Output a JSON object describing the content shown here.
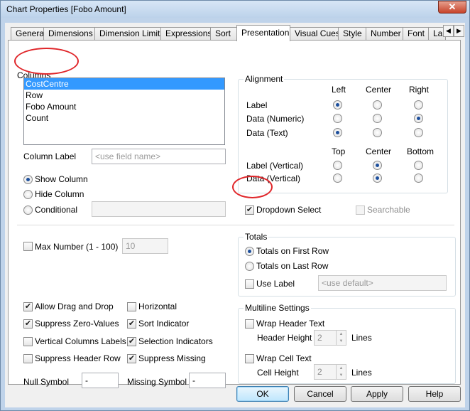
{
  "window": {
    "title": "Chart Properties [Fobo Amount]",
    "close_glyph": "✕"
  },
  "tabs": [
    "General",
    "Dimensions",
    "Dimension Limits",
    "Expressions",
    "Sort",
    "Presentation",
    "Visual Cues",
    "Style",
    "Number",
    "Font",
    "La"
  ],
  "active_tab": "Presentation",
  "tab_scroll": {
    "left": "◀",
    "right": "▶"
  },
  "columns": {
    "label": "Columns",
    "items": [
      "CostCentre",
      "Row",
      "Fobo Amount",
      "Count"
    ],
    "selected": "CostCentre",
    "column_label_text": "Column Label",
    "column_label_placeholder": "<use field name>",
    "show_column": "Show Column",
    "hide_column": "Hide Column",
    "conditional": "Conditional"
  },
  "alignment": {
    "label": "Alignment",
    "headers": [
      "Left",
      "Center",
      "Right"
    ],
    "rows": [
      {
        "label": "Label",
        "selected": "Left"
      },
      {
        "label": "Data (Numeric)",
        "selected": "Right"
      },
      {
        "label": "Data (Text)",
        "selected": "Left"
      }
    ],
    "vheaders": [
      "Top",
      "Center",
      "Bottom"
    ],
    "vrows": [
      {
        "label": "Label (Vertical)",
        "selected": "Center"
      },
      {
        "label": "Data (Vertical)",
        "selected": "Center"
      }
    ]
  },
  "dropdown_select": {
    "label": "Dropdown Select",
    "checked": true
  },
  "searchable": {
    "label": "Searchable",
    "checked": false
  },
  "max_number": {
    "label": "Max Number (1 - 100)",
    "value": "10"
  },
  "totals": {
    "label": "Totals",
    "first_row": "Totals on First Row",
    "last_row": "Totals on Last Row",
    "use_label": "Use Label",
    "use_label_placeholder": "<use default>"
  },
  "options": {
    "allow_drag_drop": "Allow Drag and Drop",
    "suppress_zero": "Suppress Zero-Values",
    "vertical_col_labels": "Vertical Columns Labels",
    "suppress_header": "Suppress Header Row",
    "horizontal": "Horizontal",
    "sort_indicator": "Sort Indicator",
    "selection_indicators": "Selection Indicators",
    "suppress_missing": "Suppress Missing"
  },
  "null_symbol": {
    "label": "Null Symbol",
    "value": "-"
  },
  "missing_symbol": {
    "label": "Missing Symbol",
    "value": "-"
  },
  "multiline": {
    "label": "Multiline Settings",
    "wrap_header": "Wrap Header Text",
    "header_height": "Header Height",
    "header_value": "2",
    "wrap_cell": "Wrap Cell Text",
    "cell_height": "Cell Height",
    "cell_value": "2",
    "lines": "Lines"
  },
  "buttons": {
    "ok": "OK",
    "cancel": "Cancel",
    "apply": "Apply",
    "help": "Help"
  },
  "check_glyph": "✔"
}
